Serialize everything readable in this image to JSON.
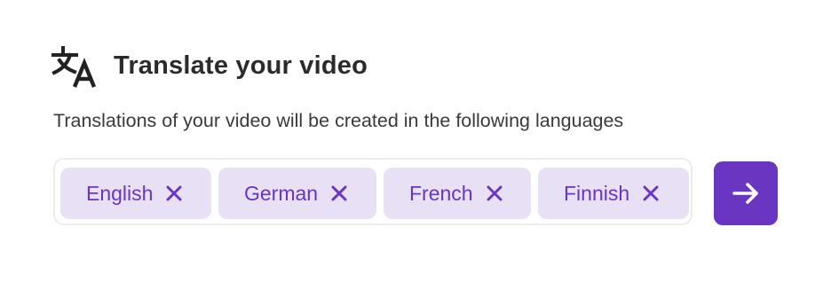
{
  "header": {
    "icon": "translate-icon",
    "title": "Translate your video"
  },
  "description": "Translations of your video will be created in the following languages",
  "languages": [
    {
      "label": "English",
      "remove_icon": "close-icon"
    },
    {
      "label": "German",
      "remove_icon": "close-icon"
    },
    {
      "label": "French",
      "remove_icon": "close-icon"
    },
    {
      "label": "Finnish",
      "remove_icon": "close-icon"
    }
  ],
  "submit": {
    "icon": "arrow-right-icon"
  },
  "colors": {
    "accent": "#6a36c1",
    "chip_background": "#e8e1f5",
    "chip_text": "#6a35c2",
    "title_text": "#2b2b2b",
    "border": "#ececec"
  }
}
